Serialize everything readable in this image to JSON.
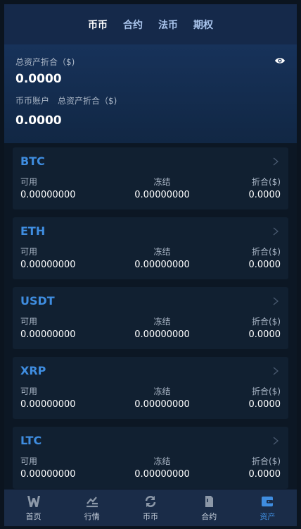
{
  "tabs": [
    {
      "label": "币币"
    },
    {
      "label": "合约"
    },
    {
      "label": "法币"
    },
    {
      "label": "期权"
    }
  ],
  "summary": {
    "total_label": "总资产折合（$)",
    "total_value": "0.0000",
    "account_label": "币币账户",
    "account_total_label": "总资产折合（$)",
    "account_value": "0.0000",
    "eye_icon": "eye-icon"
  },
  "columns": {
    "available": "可用",
    "frozen": "冻结",
    "converted": "折合($)"
  },
  "assets": [
    {
      "coin": "BTC",
      "available": "0.00000000",
      "frozen": "0.00000000",
      "converted": "0.0000"
    },
    {
      "coin": "ETH",
      "available": "0.00000000",
      "frozen": "0.00000000",
      "converted": "0.0000"
    },
    {
      "coin": "USDT",
      "available": "0.00000000",
      "frozen": "0.00000000",
      "converted": "0.0000"
    },
    {
      "coin": "XRP",
      "available": "0.00000000",
      "frozen": "0.00000000",
      "converted": "0.0000"
    },
    {
      "coin": "LTC",
      "available": "0.00000000",
      "frozen": "0.00000000",
      "converted": "0.0000"
    }
  ],
  "nav": [
    {
      "label": "首页",
      "icon": "home-w-icon"
    },
    {
      "label": "行情",
      "icon": "market-chart-icon"
    },
    {
      "label": "币币",
      "icon": "exchange-icon"
    },
    {
      "label": "合约",
      "icon": "contract-doc-icon"
    },
    {
      "label": "资产",
      "icon": "wallet-icon"
    }
  ],
  "colors": {
    "accent": "#3f8de0",
    "header": "#15294a",
    "card": "#112031",
    "nav": "#1a2c48"
  }
}
